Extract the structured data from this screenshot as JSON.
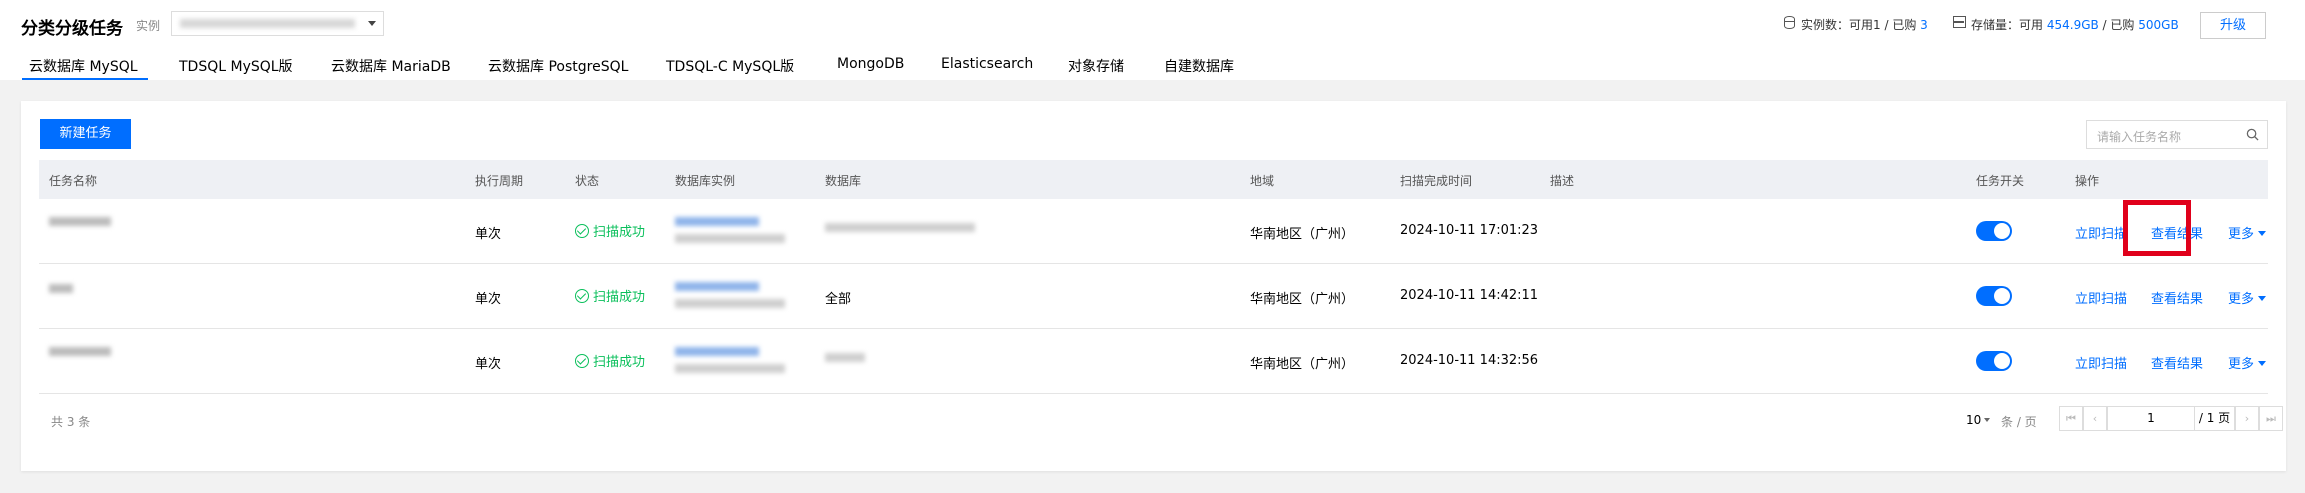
{
  "header": {
    "title": "分类分级任务",
    "instance_label": "实例",
    "instance_count_label": "实例数：可用",
    "instance_available": "1",
    "instance_sep": " / 已购",
    "instance_purchased": "3",
    "storage_label": "存储量：可用",
    "storage_available": "454.9GB",
    "storage_sep": " / 已购",
    "storage_purchased": "500GB",
    "upgrade_label": "升级"
  },
  "tabs": [
    {
      "label": "云数据库 MySQL",
      "active": true
    },
    {
      "label": "TDSQL MySQL版"
    },
    {
      "label": "云数据库 MariaDB"
    },
    {
      "label": "云数据库 PostgreSQL"
    },
    {
      "label": "TDSQL-C MySQL版"
    },
    {
      "label": "MongoDB"
    },
    {
      "label": "Elasticsearch"
    },
    {
      "label": "对象存储"
    },
    {
      "label": "自建数据库"
    }
  ],
  "toolbar": {
    "new_task_label": "新建任务",
    "search_placeholder": "请输入任务名称"
  },
  "table": {
    "columns": [
      "任务名称",
      "执行周期",
      "状态",
      "数据库实例",
      "数据库",
      "地域",
      "扫描完成时间",
      "描述",
      "任务开关",
      "操作"
    ],
    "rows": [
      {
        "cycle": "单次",
        "status": "扫描成功",
        "database": "",
        "region": "华南地区（广州）",
        "finished": "2024-10-11 17:01:23",
        "desc": "",
        "enabled": true,
        "actions": [
          "立即扫描",
          "查看结果",
          "更多"
        ]
      },
      {
        "cycle": "单次",
        "status": "扫描成功",
        "database": "全部",
        "region": "华南地区（广州）",
        "finished": "2024-10-11 14:42:11",
        "desc": "",
        "enabled": true,
        "actions": [
          "立即扫描",
          "查看结果",
          "更多"
        ]
      },
      {
        "cycle": "单次",
        "status": "扫描成功",
        "database": "",
        "region": "华南地区（广州）",
        "finished": "2024-10-11 14:32:56",
        "desc": "",
        "enabled": true,
        "actions": [
          "立即扫描",
          "查看结果",
          "更多"
        ]
      }
    ]
  },
  "pagination": {
    "total_text": "共 3 条",
    "page_size": "10",
    "per_page_label": "条 / 页",
    "current_page": "1",
    "total_pages": "/ 1 页"
  },
  "colors": {
    "accent": "#006eff",
    "success": "#0abf5b",
    "highlight": "#e0001b"
  }
}
